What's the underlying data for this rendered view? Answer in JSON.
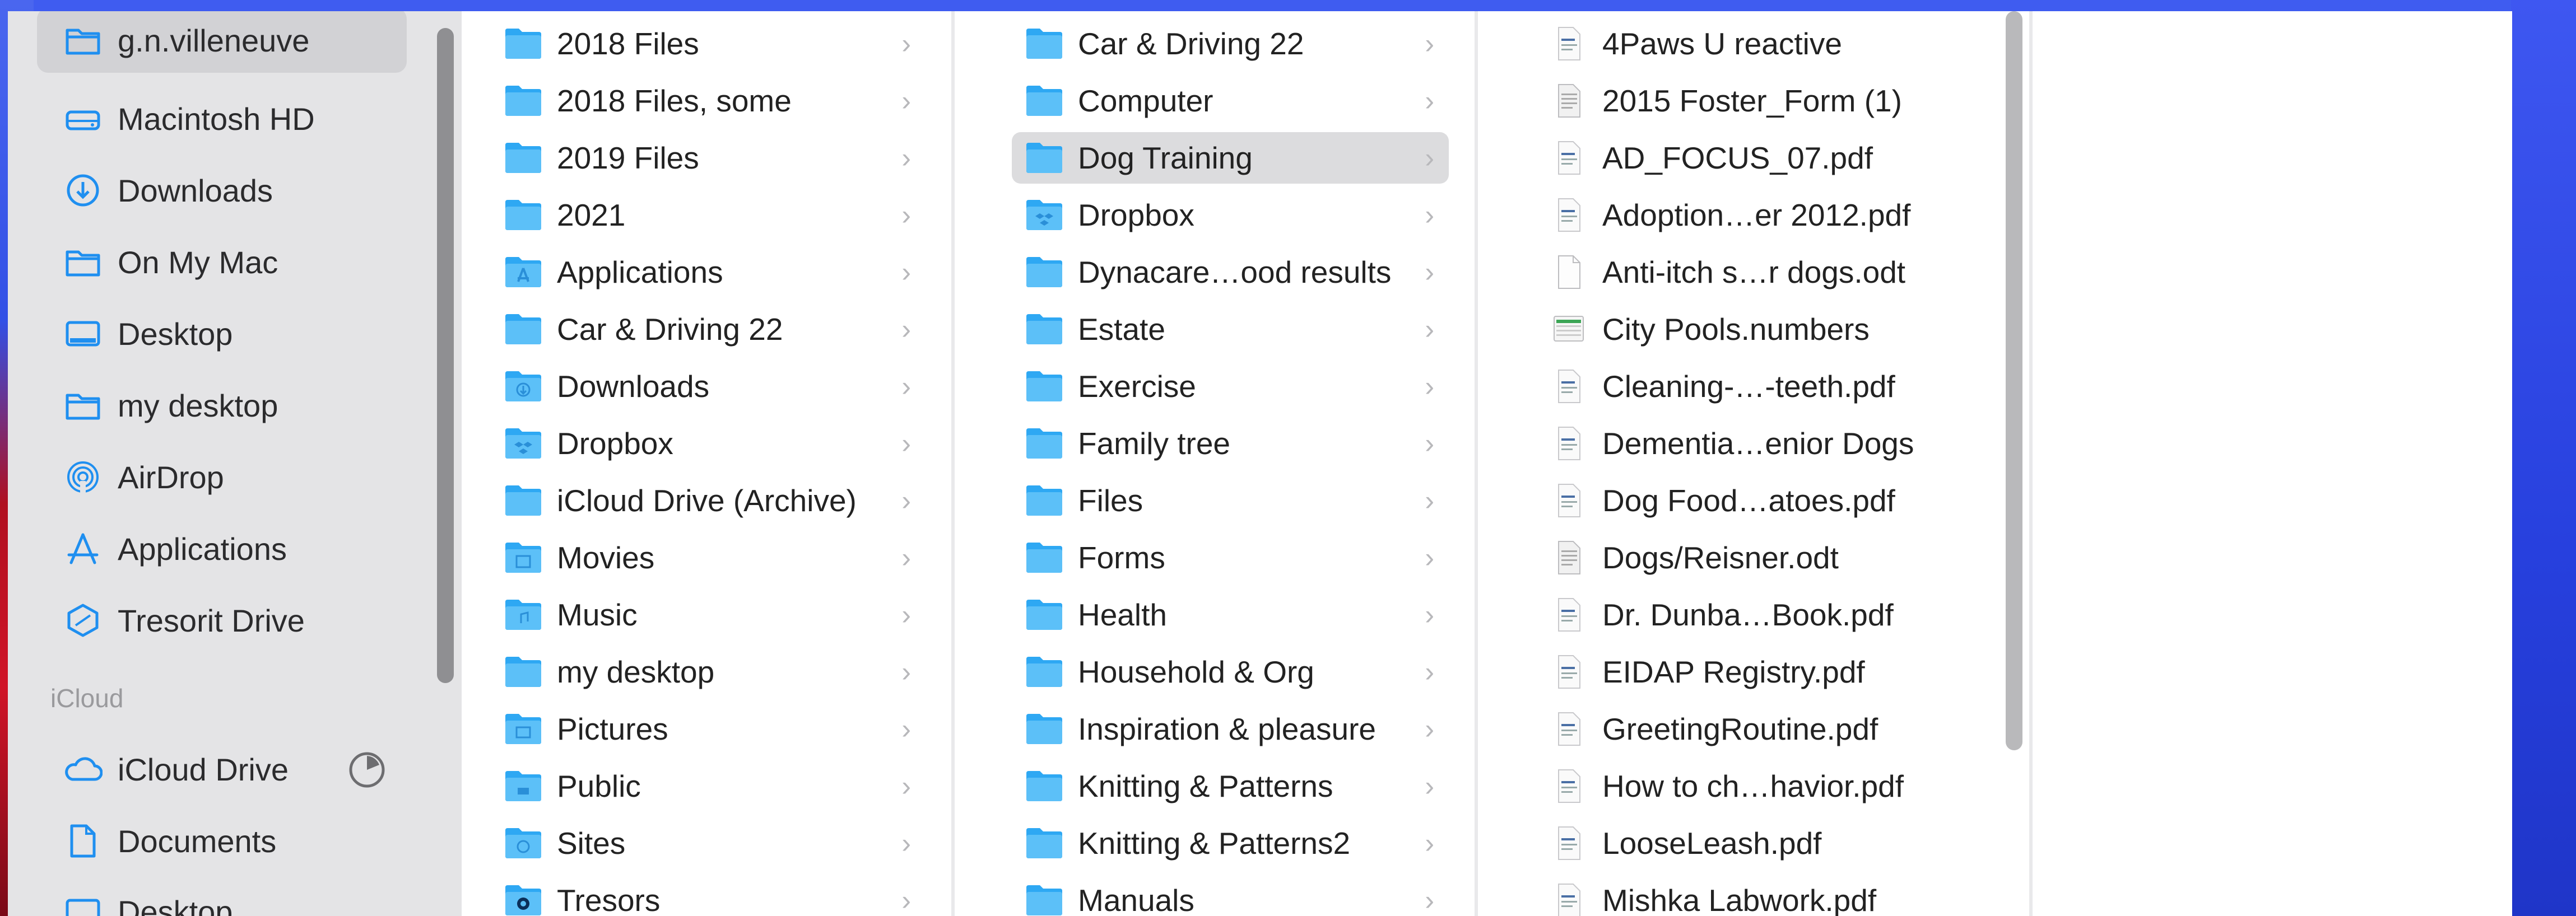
{
  "sidebar": {
    "items": [
      {
        "label": "g.n.villeneuve",
        "icon": "home-folder-icon",
        "selected": true
      },
      {
        "label": "Macintosh HD",
        "icon": "hard-drive-icon"
      },
      {
        "label": "Downloads",
        "icon": "download-icon"
      },
      {
        "label": "On My Mac",
        "icon": "folder-icon"
      },
      {
        "label": "Desktop",
        "icon": "desktop-icon"
      },
      {
        "label": "my desktop",
        "icon": "folder-icon"
      },
      {
        "label": "AirDrop",
        "icon": "airdrop-icon"
      },
      {
        "label": "Applications",
        "icon": "applications-icon"
      },
      {
        "label": "Tresorit Drive",
        "icon": "tresorit-icon"
      }
    ],
    "icloud_header": "iCloud",
    "icloud_items": [
      {
        "label": "iCloud Drive",
        "icon": "cloud-icon",
        "status_icon": "sync-progress-icon"
      },
      {
        "label": "Documents",
        "icon": "document-icon"
      },
      {
        "label": "Desktop",
        "icon": "desktop-icon"
      }
    ]
  },
  "columns": [
    {
      "items": [
        {
          "name": "2018 Files",
          "icon": "folder-icon"
        },
        {
          "name": "2018 Files, some",
          "icon": "folder-icon"
        },
        {
          "name": "2019 Files",
          "icon": "folder-icon"
        },
        {
          "name": "2021",
          "icon": "folder-icon"
        },
        {
          "name": "Applications",
          "icon": "applications-folder-icon"
        },
        {
          "name": "Car & Driving 22",
          "icon": "folder-icon"
        },
        {
          "name": "Downloads",
          "icon": "downloads-folder-icon"
        },
        {
          "name": "Dropbox",
          "icon": "dropbox-folder-icon"
        },
        {
          "name": "iCloud Drive (Archive)",
          "icon": "folder-icon"
        },
        {
          "name": "Movies",
          "icon": "movies-folder-icon"
        },
        {
          "name": "Music",
          "icon": "music-folder-icon"
        },
        {
          "name": "my desktop",
          "icon": "folder-icon"
        },
        {
          "name": "Pictures",
          "icon": "pictures-folder-icon"
        },
        {
          "name": "Public",
          "icon": "public-folder-icon"
        },
        {
          "name": "Sites",
          "icon": "sites-folder-icon"
        },
        {
          "name": "Tresors",
          "icon": "tresors-folder-icon"
        }
      ]
    },
    {
      "items": [
        {
          "name": "Car & Driving 22",
          "icon": "folder-icon"
        },
        {
          "name": "Computer",
          "icon": "folder-icon"
        },
        {
          "name": "Dog Training",
          "icon": "folder-icon",
          "selected": true
        },
        {
          "name": "Dropbox",
          "icon": "dropbox-folder-icon"
        },
        {
          "name": "Dynacare…ood results",
          "icon": "folder-icon"
        },
        {
          "name": "Estate",
          "icon": "folder-icon"
        },
        {
          "name": "Exercise",
          "icon": "folder-icon"
        },
        {
          "name": "Family tree",
          "icon": "folder-icon"
        },
        {
          "name": "Files",
          "icon": "folder-icon"
        },
        {
          "name": "Forms",
          "icon": "folder-icon"
        },
        {
          "name": "Health",
          "icon": "folder-icon"
        },
        {
          "name": "Household & Org",
          "icon": "folder-icon"
        },
        {
          "name": "Inspiration & pleasure",
          "icon": "folder-icon"
        },
        {
          "name": "Knitting & Patterns",
          "icon": "folder-icon"
        },
        {
          "name": "Knitting & Patterns2",
          "icon": "folder-icon"
        },
        {
          "name": "Manuals",
          "icon": "folder-icon"
        }
      ]
    },
    {
      "items": [
        {
          "name": "4Paws U reactive",
          "icon": "pdf-file-icon"
        },
        {
          "name": "2015 Foster_Form (1)",
          "icon": "document-file-icon"
        },
        {
          "name": "AD_FOCUS_07.pdf",
          "icon": "pdf-file-icon"
        },
        {
          "name": "Adoption…er 2012.pdf",
          "icon": "pdf-file-icon"
        },
        {
          "name": "Anti-itch s…r dogs.odt",
          "icon": "blank-file-icon"
        },
        {
          "name": "City Pools.numbers",
          "icon": "numbers-file-icon"
        },
        {
          "name": "Cleaning-…-teeth.pdf",
          "icon": "pdf-file-icon"
        },
        {
          "name": "Dementia…enior Dogs",
          "icon": "pdf-file-icon"
        },
        {
          "name": "Dog Food…atoes.pdf",
          "icon": "pdf-file-icon"
        },
        {
          "name": "Dogs/Reisner.odt",
          "icon": "document-file-icon"
        },
        {
          "name": "Dr. Dunba…Book.pdf",
          "icon": "pdf-file-icon"
        },
        {
          "name": "EIDAP Registry.pdf",
          "icon": "pdf-file-icon"
        },
        {
          "name": "GreetingRoutine.pdf",
          "icon": "pdf-file-icon"
        },
        {
          "name": "How to ch…havior.pdf",
          "icon": "pdf-file-icon"
        },
        {
          "name": "LooseLeash.pdf",
          "icon": "pdf-file-icon"
        },
        {
          "name": "Mishka Labwork.pdf",
          "icon": "pdf-file-icon"
        }
      ]
    }
  ],
  "chevron": "›",
  "colors": {
    "accent": "#1da1f2",
    "selection": "#dcdcde",
    "sidebar_bg": "#e4e4e6"
  }
}
